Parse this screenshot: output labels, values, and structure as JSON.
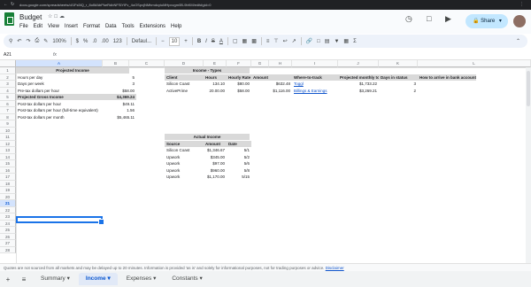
{
  "browser": {
    "url": "docs.google.com/spreadsheets/d/1Fs5lQ_r_8oIMAbPkeRdbNFSlYlFv_4oOSpvjNMhmdcyiuMHpcvgm0B-9bKM/edit#gid=0"
  },
  "app": {
    "title": "Budget",
    "menus": [
      "File",
      "Edit",
      "View",
      "Insert",
      "Format",
      "Data",
      "Tools",
      "Extensions",
      "Help"
    ],
    "share_label": "Share"
  },
  "toolbar": {
    "zoom": "100%",
    "font": "Defaul...",
    "font_size": "10",
    "format_number": "123"
  },
  "formula_bar": {
    "cell_ref": "A21",
    "fx": "fx"
  },
  "columns": [
    "A",
    "B",
    "C",
    "D",
    "E",
    "F",
    "G",
    "H",
    "I",
    "J",
    "K",
    "L"
  ],
  "rows": [
    "1",
    "2",
    "3",
    "4",
    "5",
    "6",
    "7",
    "8",
    "9",
    "10",
    "11",
    "12",
    "13",
    "14",
    "15",
    "16",
    "17",
    "18",
    "19",
    "20",
    "21",
    "22",
    "23",
    "24",
    "25",
    "26",
    "27",
    "28"
  ],
  "sheet": {
    "projected_income": {
      "header": "Projected Income",
      "rows": [
        {
          "label": "Hours per day",
          "value": "5"
        },
        {
          "label": "Days per week",
          "value": "3"
        },
        {
          "label": "Pre-tax dollars per hour",
          "value": "$58.00"
        },
        {
          "label": "Projected Gross Income",
          "value": "$4,369.24"
        },
        {
          "label": "Post-tax dollars per hour",
          "value": "$49.11"
        },
        {
          "label": "Post-tax dollars per hour (full-time equivalent)",
          "value": "1.56"
        },
        {
          "label": "Post-tax dollars per month",
          "value": "$5,465.11"
        }
      ]
    },
    "income_types": {
      "header": "Income - Types",
      "columns": [
        "Client",
        "Hours",
        "Hourly Rate",
        "Amount",
        "Where-to-track",
        "Projected monthly total",
        "Days in status",
        "How to arrive in bank account"
      ],
      "rows": [
        [
          "Silicon Coast",
          "134.10",
          "$80.00",
          "$632.48",
          "Toggl",
          "$1,733.22",
          "3",
          ""
        ],
        [
          "ActivePrime",
          "20.00.00",
          "$58.00",
          "$1,116.00",
          "Billings & Earnings",
          "$3,269.21",
          "2",
          ""
        ]
      ]
    },
    "actual_income": {
      "header": "Actual Income",
      "columns": [
        "Source",
        "Amount",
        "Date"
      ],
      "rows": [
        [
          "Silicon Coast",
          "$1,346.67",
          "5/1"
        ],
        [
          "Upwork",
          "$345.00",
          "5/2"
        ],
        [
          "Upwork",
          "$97.00",
          "5/6"
        ],
        [
          "Upwork",
          "$960.00",
          "5/8"
        ],
        [
          "Upwork",
          "$1,170.00",
          "5/15"
        ]
      ]
    }
  },
  "disclaimer": {
    "text": "Quotes are not sourced from all markets and may be delayed up to 20 minutes. Information is provided 'as is' and solely for informational purposes, not for trading purposes or advice.",
    "link": "Disclaimer"
  },
  "tabs": [
    {
      "label": "Summary",
      "active": false
    },
    {
      "label": "Income",
      "active": true
    },
    {
      "label": "Expenses",
      "active": false
    },
    {
      "label": "Constants",
      "active": false
    }
  ],
  "colors": {
    "accent": "#1a73e8",
    "share_bg": "#c2e7ff",
    "header_gray": "#d9d9d9",
    "sheets_green": "#188038"
  }
}
